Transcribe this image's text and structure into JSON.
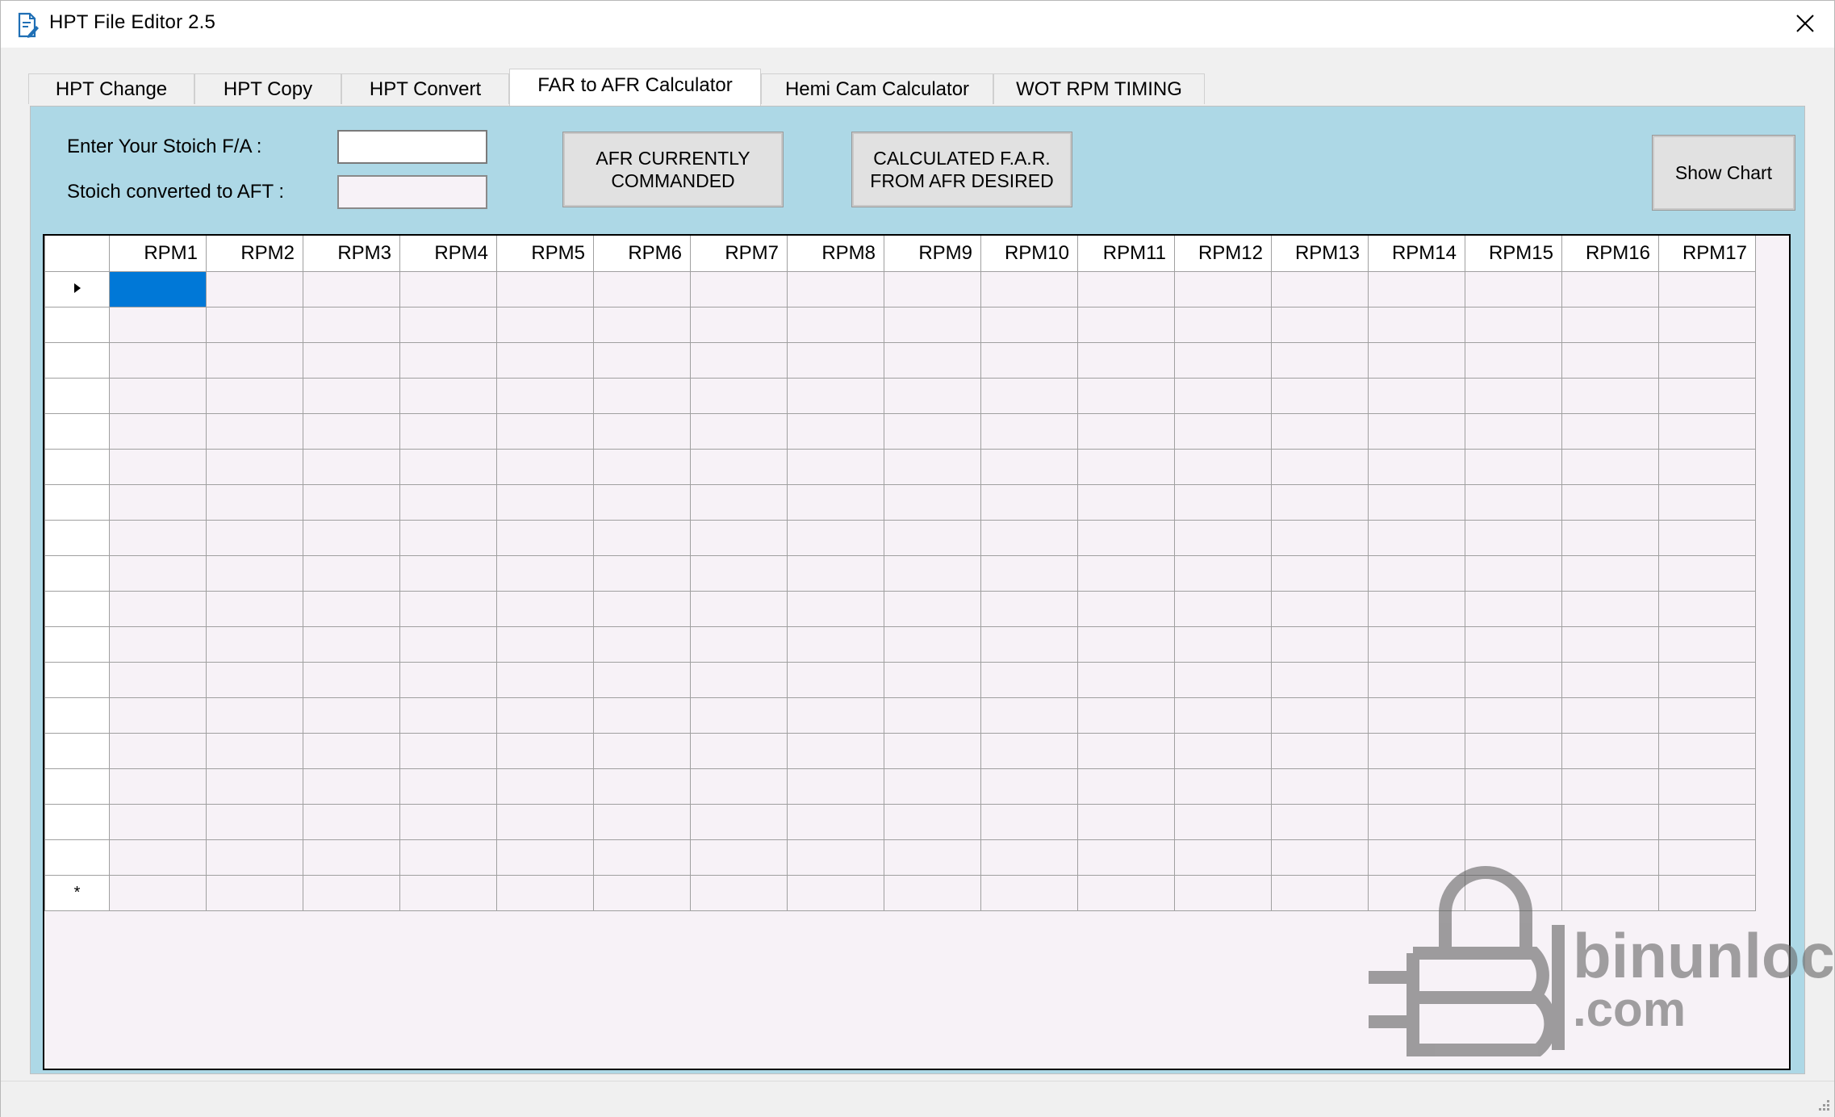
{
  "window": {
    "title": "HPT File Editor 2.5"
  },
  "tabs": [
    {
      "label": "HPT Change",
      "active": false
    },
    {
      "label": "HPT Copy",
      "active": false
    },
    {
      "label": "HPT Convert",
      "active": false
    },
    {
      "label": "FAR to AFR Calculator",
      "active": true
    },
    {
      "label": "Hemi Cam Calculator",
      "active": false
    },
    {
      "label": "WOT RPM TIMING",
      "active": false
    }
  ],
  "form": {
    "stoich_label": "Enter Your Stoich F/A :",
    "stoich_value": "",
    "converted_label": "Stoich converted to AFT :",
    "converted_value": ""
  },
  "buttons": {
    "afr_line1": "AFR CURRENTLY",
    "afr_line2": "COMMANDED",
    "far_line1": "CALCULATED F.A.R.",
    "far_line2": "FROM AFR DESIRED",
    "show_chart": "Show Chart"
  },
  "grid": {
    "columns": [
      "RPM1",
      "RPM2",
      "RPM3",
      "RPM4",
      "RPM5",
      "RPM6",
      "RPM7",
      "RPM8",
      "RPM9",
      "RPM10",
      "RPM11",
      "RPM12",
      "RPM13",
      "RPM14",
      "RPM15",
      "RPM16",
      "RPM17"
    ],
    "row_count": 18,
    "new_row_marker": "*"
  },
  "watermark": {
    "line1": "binunlock",
    "line2": ".com"
  },
  "colors": {
    "panel_bg": "#add8e6",
    "grid_bg": "#f7f2f7",
    "selection": "#0078d7"
  }
}
